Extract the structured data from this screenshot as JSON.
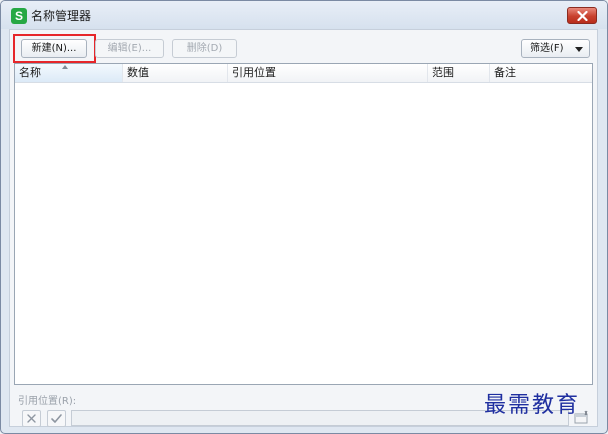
{
  "window": {
    "title": "名称管理器",
    "app_icon_glyph": "S",
    "app_icon_color": "#27a844",
    "close_color": "#c8412e"
  },
  "toolbar": {
    "new_label": "新建(N)...",
    "edit_label": "编辑(E)...",
    "delete_label": "删除(D)",
    "filter_label": "筛选(F)",
    "highlight_color": "#e6262a"
  },
  "table": {
    "columns": [
      "名称",
      "数值",
      "引用位置",
      "范围",
      "备注"
    ],
    "rows": []
  },
  "footer": {
    "ref_label": "引用位置(R):",
    "ref_value": "",
    "cancel_icon": "x-icon",
    "confirm_icon": "check-icon",
    "range_icon": "range-select-icon"
  },
  "watermark": {
    "text": "最需教育",
    "color": "#1f2fa0"
  }
}
